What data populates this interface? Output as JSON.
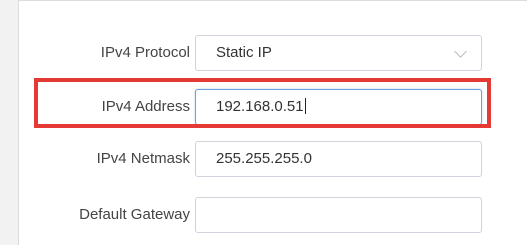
{
  "form": {
    "protocol": {
      "label": "IPv4 Protocol",
      "value": "Static IP"
    },
    "address": {
      "label": "IPv4 Address",
      "value": "192.168.0.51"
    },
    "netmask": {
      "label": "IPv4 Netmask",
      "value": "255.255.255.0"
    },
    "gateway": {
      "label": "Default Gateway",
      "value": ""
    }
  },
  "highlight_color": "#e53935"
}
